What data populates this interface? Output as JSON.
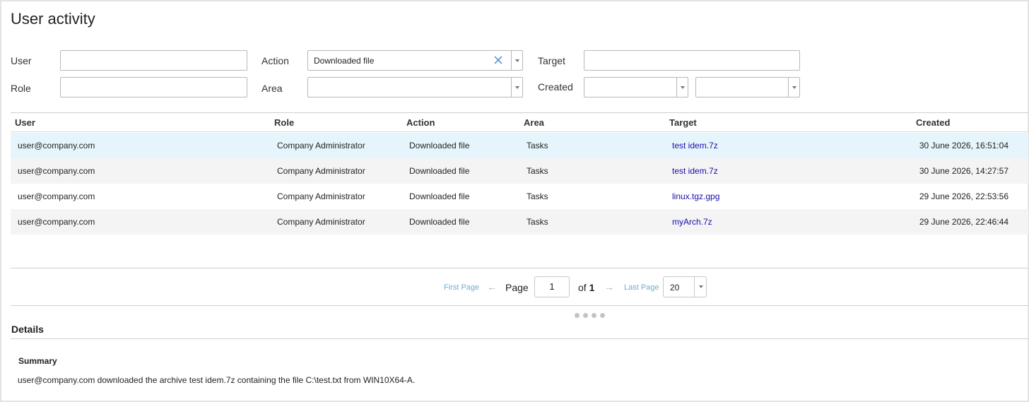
{
  "title": "User activity",
  "filters": {
    "user_label": "User",
    "role_label": "Role",
    "action_label": "Action",
    "action_value": "Downloaded file",
    "area_label": "Area",
    "target_label": "Target",
    "created_label": "Created"
  },
  "columns": [
    "User",
    "Role",
    "Action",
    "Area",
    "Target",
    "Created"
  ],
  "rows": [
    {
      "user": "user@company.com",
      "role": "Company Administrator",
      "action": "Downloaded file",
      "area": "Tasks",
      "target": "test idem.7z",
      "created": "30 June 2026, 16:51:04",
      "selected": true
    },
    {
      "user": "user@company.com",
      "role": "Company Administrator",
      "action": "Downloaded file",
      "area": "Tasks",
      "target": "test idem.7z",
      "created": "30 June 2026, 14:27:57",
      "selected": false
    },
    {
      "user": "user@company.com",
      "role": "Company Administrator",
      "action": "Downloaded file",
      "area": "Tasks",
      "target": "linux.tgz.gpg",
      "created": "29 June 2026, 22:53:56",
      "selected": false
    },
    {
      "user": "user@company.com",
      "role": "Company Administrator",
      "action": "Downloaded file",
      "area": "Tasks",
      "target": "myArch.7z",
      "created": "29 June 2026, 22:46:44",
      "selected": false
    }
  ],
  "pager": {
    "first_page": "First Page",
    "prev_arrow": "←",
    "page_label": "Page",
    "current_page": "1",
    "of_label": "of",
    "total_pages": "1",
    "next_arrow": "→",
    "last_page": "Last Page",
    "page_size": "20"
  },
  "details": {
    "title": "Details",
    "summary_title": "Summary",
    "summary_text": "user@company.com downloaded the archive test idem.7z containing the file C:\\test.txt from WIN10X64-A."
  },
  "colors": {
    "selected_row": "#e6f5fb",
    "alt_row": "#f4f4f4",
    "link": "#1a0dab",
    "pager_link": "#6aaed6"
  }
}
